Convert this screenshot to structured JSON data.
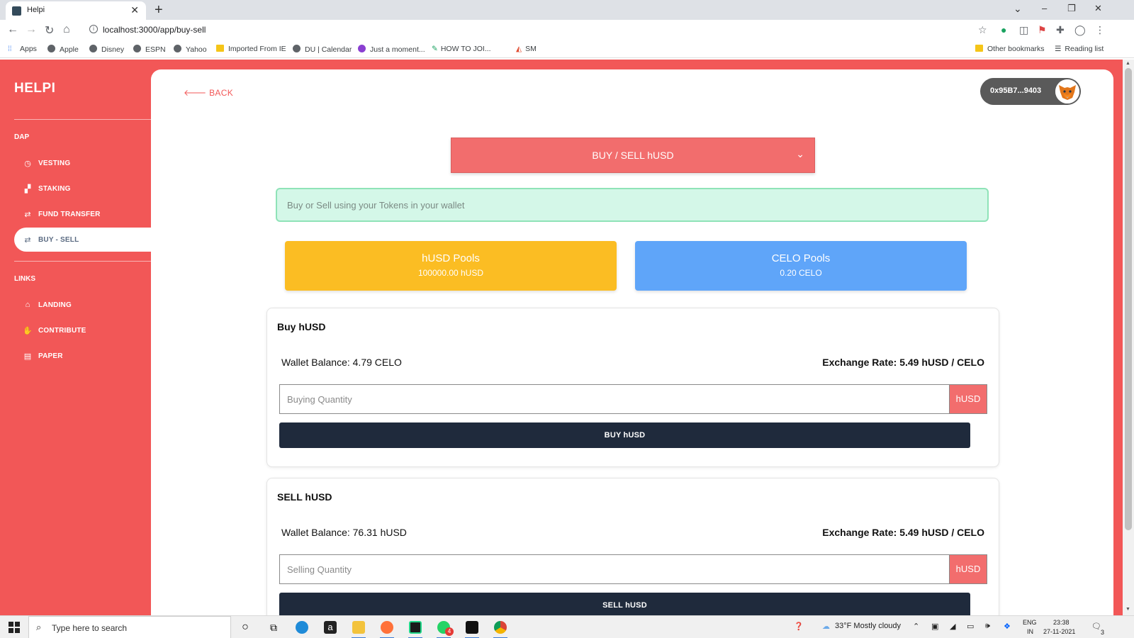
{
  "browser": {
    "tab_title": "Helpi",
    "tab_close": "✕",
    "new_tab": "+",
    "url": "localhost:3000/app/buy-sell",
    "window_controls": {
      "minimize": "–",
      "restore": "❐",
      "close": "✕",
      "tab_search": "⌄"
    },
    "bookmarks": [
      {
        "label": "Apps",
        "icon": "apps-grid-icon"
      },
      {
        "label": "Apple",
        "icon": "globe-icon"
      },
      {
        "label": "Disney",
        "icon": "globe-icon"
      },
      {
        "label": "ESPN",
        "icon": "globe-icon"
      },
      {
        "label": "Yahoo",
        "icon": "globe-icon"
      },
      {
        "label": "Imported From IE",
        "icon": "folder-icon"
      },
      {
        "label": "DU | Calendar",
        "icon": "globe-icon"
      },
      {
        "label": "Just a moment...",
        "icon": "purple-flower-icon"
      },
      {
        "label": "HOW TO JOI...",
        "icon": "pencil-icon"
      },
      {
        "label": "SM",
        "icon": "chart-icon"
      }
    ],
    "other_bookmarks": "Other bookmarks",
    "reading_list": "Reading list"
  },
  "sidebar": {
    "brand": "HELPI",
    "section_dap": "DAP",
    "dap_items": [
      {
        "label": "VESTING",
        "icon": "clock-icon",
        "glyph": "◷",
        "active": false
      },
      {
        "label": "STAKING",
        "icon": "cubes-icon",
        "glyph": "▞",
        "active": false
      },
      {
        "label": "FUND TRANSFER",
        "icon": "exchange-icon",
        "glyph": "⇄",
        "active": false
      },
      {
        "label": "BUY - SELL",
        "icon": "exchange-icon",
        "glyph": "⇄",
        "active": true
      }
    ],
    "section_links": "LINKS",
    "link_items": [
      {
        "label": "LANDING",
        "icon": "home-icon",
        "glyph": "⌂"
      },
      {
        "label": "CONTRIBUTE",
        "icon": "handshake-icon",
        "glyph": "✋"
      },
      {
        "label": "PAPER",
        "icon": "document-icon",
        "glyph": "▤"
      }
    ]
  },
  "header": {
    "back_label": "BACK",
    "wallet_address": "0x95B7...9403"
  },
  "mode_select": {
    "label": "BUY / SELL hUSD"
  },
  "info_banner": "Buy or Sell using your Tokens in your wallet",
  "pools": [
    {
      "title": "hUSD Pools",
      "value": "100000.00 hUSD",
      "color": "#fbbd23"
    },
    {
      "title": "CELO Pools",
      "value": "0.20 CELO",
      "color": "#5fa5f9"
    }
  ],
  "buy_card": {
    "title": "Buy hUSD",
    "wallet_balance": "Wallet Balance: 4.79 CELO",
    "exchange_rate": "Exchange Rate: 5.49 hUSD / CELO",
    "quantity_placeholder": "Buying Quantity",
    "unit": "hUSD",
    "action_label": "BUY hUSD"
  },
  "sell_card": {
    "title": "SELL hUSD",
    "wallet_balance": "Wallet Balance: 76.31 hUSD",
    "exchange_rate": "Exchange Rate: 5.49 hUSD / CELO",
    "quantity_placeholder": "Selling Quantity",
    "unit": "hUSD",
    "action_label": "SELL hUSD"
  },
  "taskbar": {
    "search_placeholder": "Type here to search",
    "weather": "33°F  Mostly cloudy",
    "language_top": "ENG",
    "language_bottom": "IN",
    "time": "23:38",
    "date": "27-11-2021",
    "notification_count": "3",
    "whatsapp_badge": "4"
  },
  "colors": {
    "brand_red": "#f25757",
    "select_red": "#f26d6d",
    "navy_button": "#1f2a3c",
    "info_green": "#d4f7e8"
  }
}
